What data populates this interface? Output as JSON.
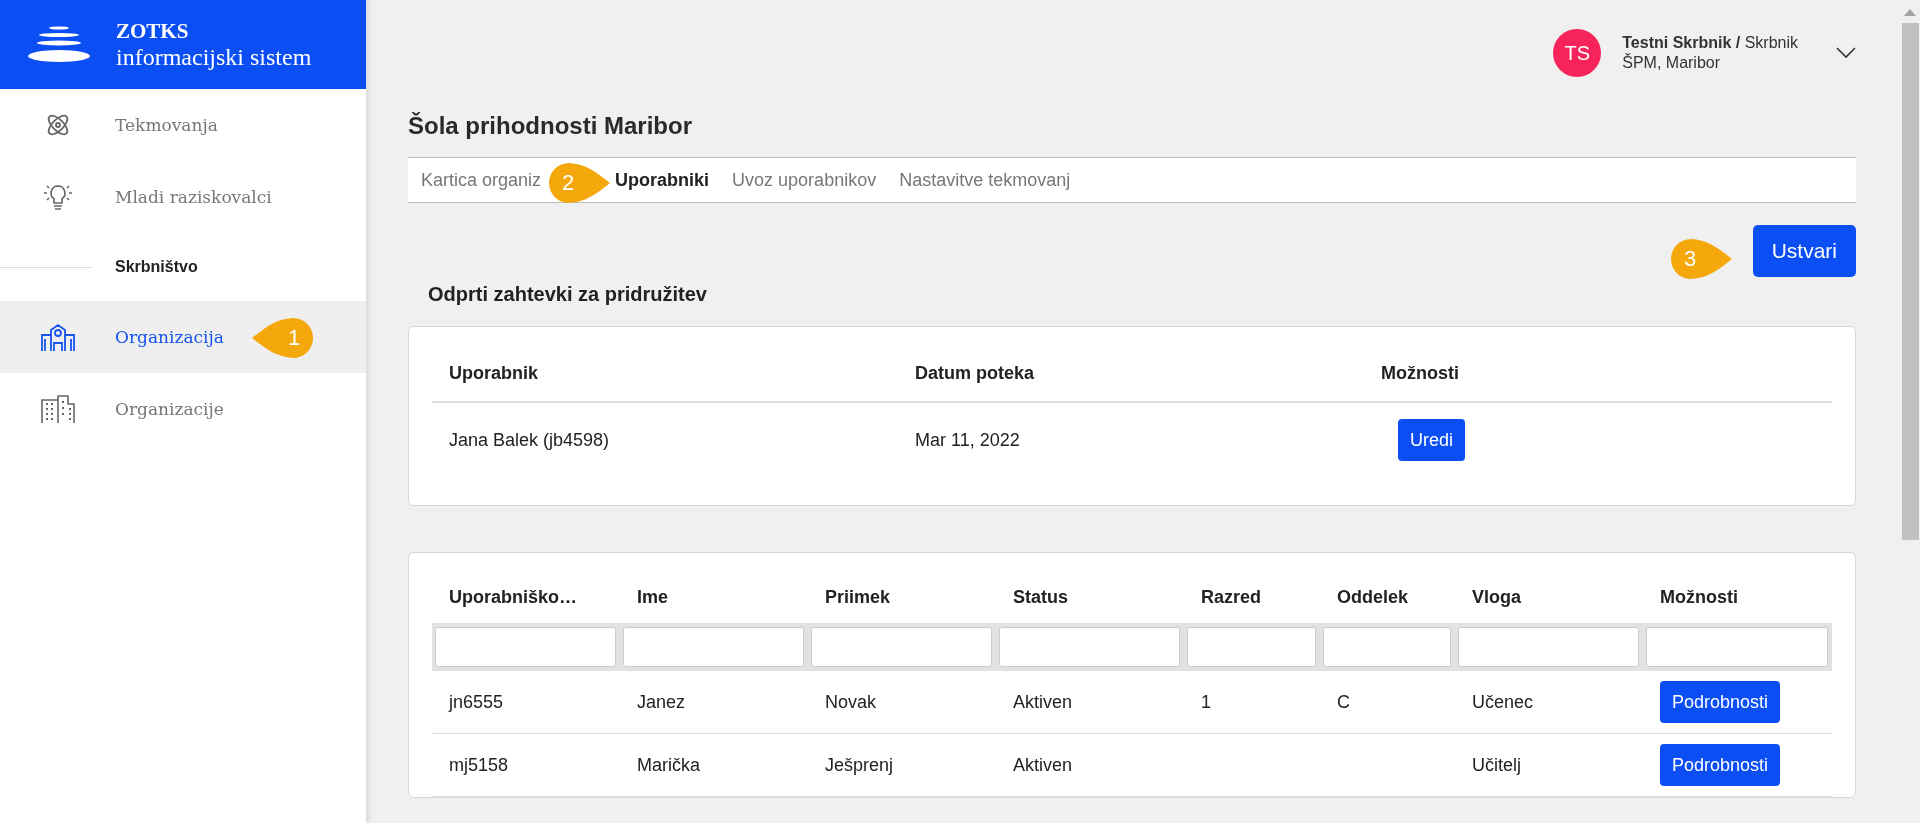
{
  "sidebar": {
    "brand": {
      "title": "ZOTKS",
      "subtitle": "informacijski sistem"
    },
    "items": [
      {
        "kind": "link",
        "label": "Tekmovanja",
        "selected": false
      },
      {
        "kind": "link",
        "label": "Mladi raziskovalci",
        "selected": false
      },
      {
        "kind": "heading",
        "label": "Skrbništvo"
      },
      {
        "kind": "link",
        "label": "Organizacija",
        "selected": true
      },
      {
        "kind": "link",
        "label": "Organizacije",
        "selected": false
      }
    ]
  },
  "user": {
    "initials": "TS",
    "name": "**Testni Skrbnik /** Skrbnik",
    "organization": "ŠPM, Maribor"
  },
  "page_title": "Šola prihodnosti Maribor",
  "tabs": [
    {
      "label": "Kartica organiz",
      "selected": false
    },
    {
      "label": "Uporabniki",
      "selected": true
    },
    {
      "label": "Uvoz uporabnikov",
      "selected": false
    },
    {
      "label": "Nastavitve tekmovanj",
      "selected": false
    }
  ],
  "create_button": "Ustvari",
  "requests": {
    "title": "Odprti zahtevki za pridružitev",
    "columns": [
      "Uporabnik",
      "Datum poteka",
      "Možnosti"
    ],
    "rows": [
      {
        "user": "Jana Balek (jb4598)",
        "date": "Mar 11, 2022",
        "action": "Uredi"
      }
    ]
  },
  "users_table": {
    "columns": [
      "Uporabniško…",
      "Ime",
      "Priimek",
      "Status",
      "Razred",
      "Oddelek",
      "Vloga",
      "Možnosti"
    ],
    "rows": [
      {
        "cells": [
          "jn6555",
          "Janez",
          "Novak",
          "Aktiven",
          "1",
          "C",
          "Učenec"
        ],
        "action": "Podrobnosti"
      },
      {
        "cells": [
          "mj5158",
          "Marička",
          "Ješprenj",
          "Aktiven",
          "",
          "",
          "Učitelj"
        ],
        "action": "Podrobnosti"
      }
    ]
  },
  "callouts": [
    {
      "label": "1",
      "kind": "point-left"
    },
    {
      "label": "2",
      "kind": "point-right"
    },
    {
      "label": "3",
      "kind": "point-right"
    }
  ]
}
